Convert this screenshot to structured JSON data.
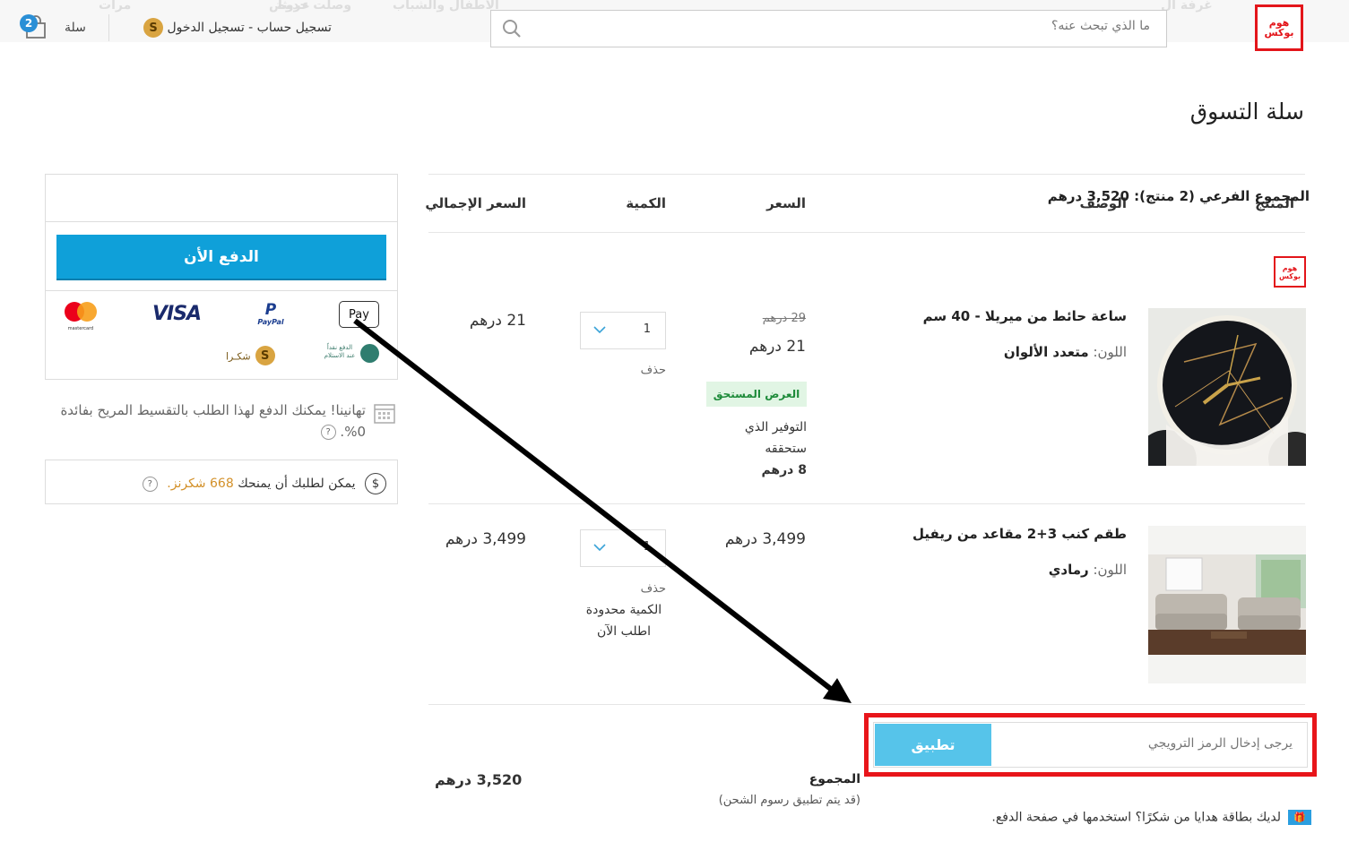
{
  "header": {
    "nav_items": [
      "غرفة ال",
      "عروض",
      "وصلت حديثاً",
      "الأطفال والشباب",
      "مرات"
    ],
    "logo_text_top": "هوم",
    "logo_text_bottom": "بوكس",
    "search_placeholder": "ما الذي تبحث عنه؟",
    "login_text": "تسجيل حساب - تسجيل الدخول",
    "coin_symbol": "S",
    "cart_label": "سلة",
    "cart_count": "2"
  },
  "page_title": "سلة التسوق",
  "table": {
    "headers": {
      "product": "المنتج",
      "description": "الوصف",
      "price": "السعر",
      "quantity": "الكمية",
      "total": "السعر الإجمالي"
    },
    "seller_logo_top": "هوم",
    "seller_logo_bottom": "بوكس",
    "items": [
      {
        "name": "ساعة حائط من ميريلا - 40 سم",
        "color_label": "اللون:",
        "color_value": "متعدد الألوان",
        "old_price": "29 درهم",
        "price": "21  درهم",
        "offer_badge": "العرض المستحق",
        "saving_text": "التوفير الذي ستحققه",
        "saving_value": "8  درهم",
        "qty": "1",
        "remove": "حذف",
        "total": "21  درهم"
      },
      {
        "name": "طقم كنب 3+2 مقاعد من ريفيل",
        "color_label": "اللون:",
        "color_value": "رمادي",
        "price": "3,499  درهم",
        "qty": "1",
        "remove": "حذف",
        "limited_text": "الكمية محدودة اطلب الآن",
        "total": "3,499  درهم"
      }
    ]
  },
  "promo": {
    "placeholder": "يرجى إدخال الرمز الترويجي",
    "apply_label": "تطبيق"
  },
  "totals": {
    "label": "المجموع",
    "note": "(قد يتم تطبيق رسوم الشحن)",
    "value": "3,520  درهم"
  },
  "gift_card_text": "لديك بطاقة هدايا من شكرًا؟ استخدمها في صفحة الدفع.",
  "summary": {
    "subtotal_text": "المجموع الفرعي (2 منتج):  3,520  درهم",
    "pay_now_label": "الدفع الأن",
    "payment_methods": {
      "applepay": "Pay",
      "paypal_top": "P",
      "paypal_text": "PayPal",
      "visa": "VISA",
      "mastercard": "mastercard",
      "cod_line1": "الدفع نقداً",
      "cod_line2": "عند الاستلام",
      "shukran_label": "شكـرا"
    },
    "installment_text": "تهانينا! يمكنك الدفع لهذا الطلب بالتقسيط المريح بفائدة 0%.",
    "shukrans_prefix": "يمكن لطلبك أن يمنحك",
    "shukrans_value": "668 شكرنز."
  },
  "colors": {
    "primary_button": "#0fa0d9",
    "apply_button": "#56c4ea",
    "highlight_box": "#e8151a",
    "brand_red": "#e3151a",
    "offer_badge_bg": "#e1f5e4"
  }
}
